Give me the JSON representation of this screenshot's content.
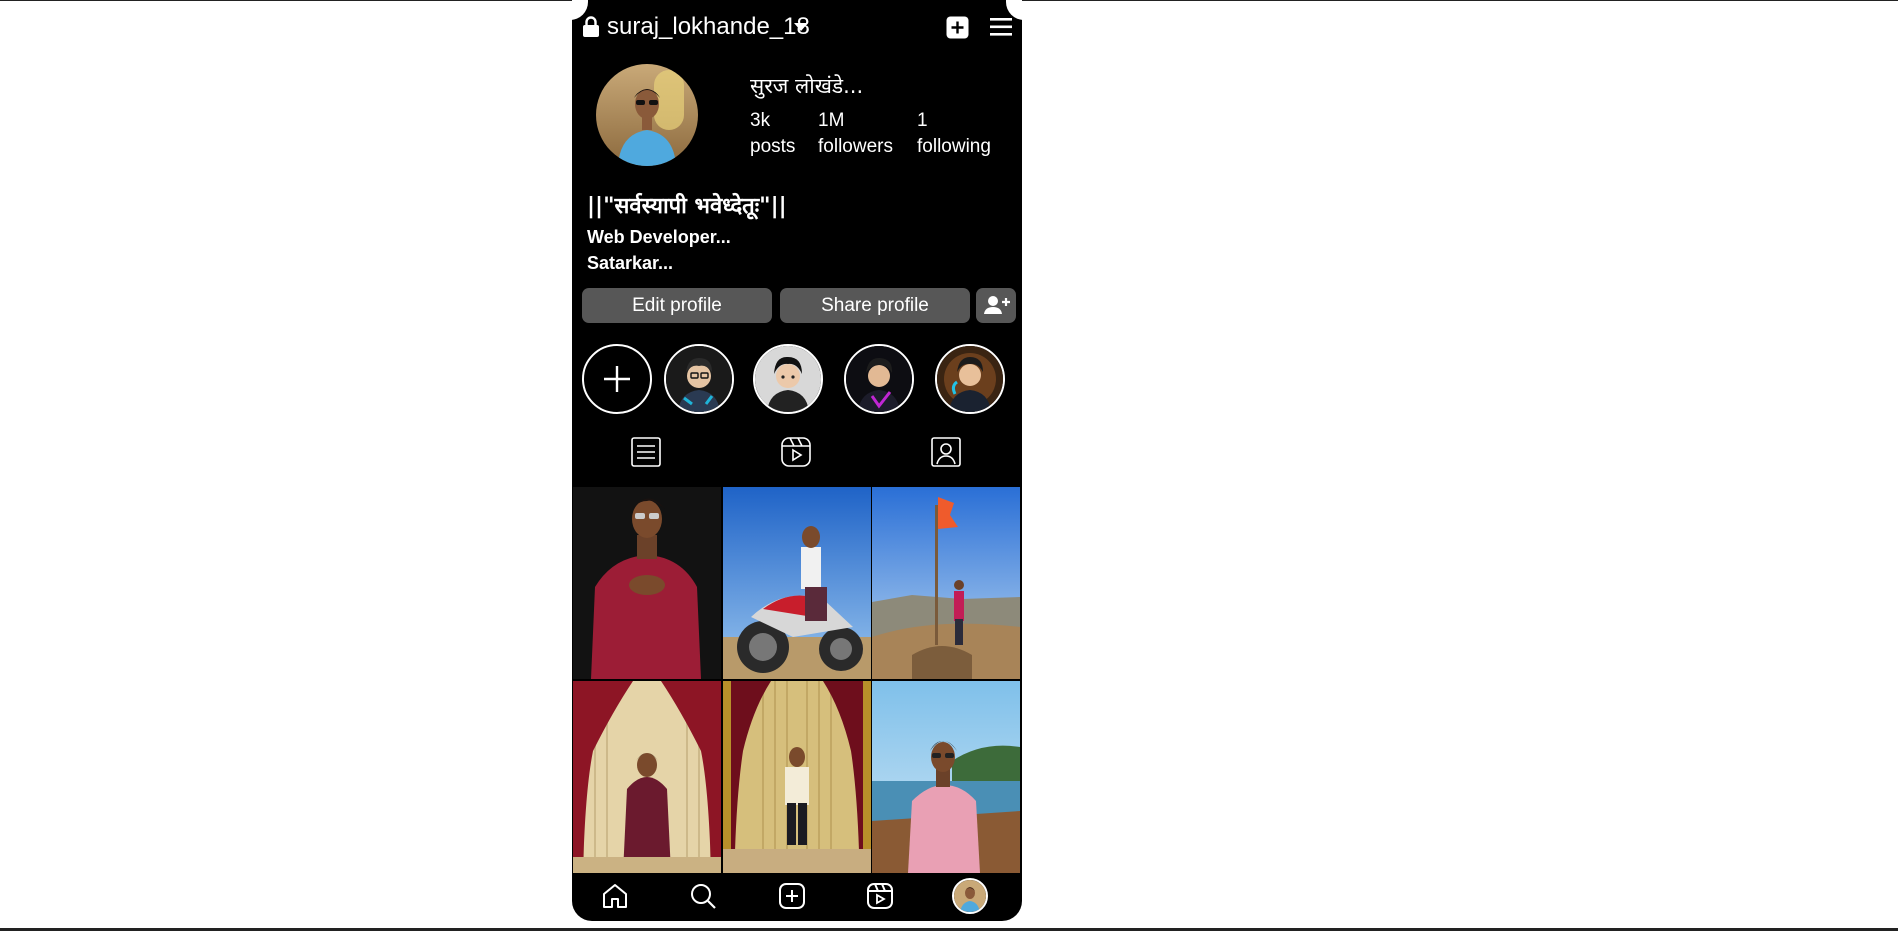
{
  "header": {
    "username": "suraj_lokhande_18",
    "icons": [
      "lock-icon",
      "chevron-down-icon",
      "new-post-icon",
      "menu-icon"
    ]
  },
  "profile": {
    "display_name": "सुरज लोखंडे...",
    "stats": [
      {
        "value": "3k",
        "label": "posts"
      },
      {
        "value": "1M",
        "label": "followers"
      },
      {
        "value": "1",
        "label": "following"
      }
    ]
  },
  "bio": {
    "title": "||\"सर्वस्यापी भवेध्देतूः\"||",
    "lines": [
      "Web Developer...",
      "Satarkar..."
    ]
  },
  "actions": {
    "edit_label": "Edit profile",
    "share_label": "Share profile"
  },
  "highlights": {
    "count": 4,
    "add_icon": "plus-icon"
  },
  "tabs": [
    "grid-tab",
    "reels-tab",
    "tagged-tab"
  ],
  "posts": {
    "count": 6
  },
  "bottom_nav": [
    "home-icon",
    "search-icon",
    "create-icon",
    "reels-icon",
    "profile-avatar"
  ],
  "colors": {
    "background": "#000000",
    "button": "#575757",
    "text": "#ffffff"
  }
}
